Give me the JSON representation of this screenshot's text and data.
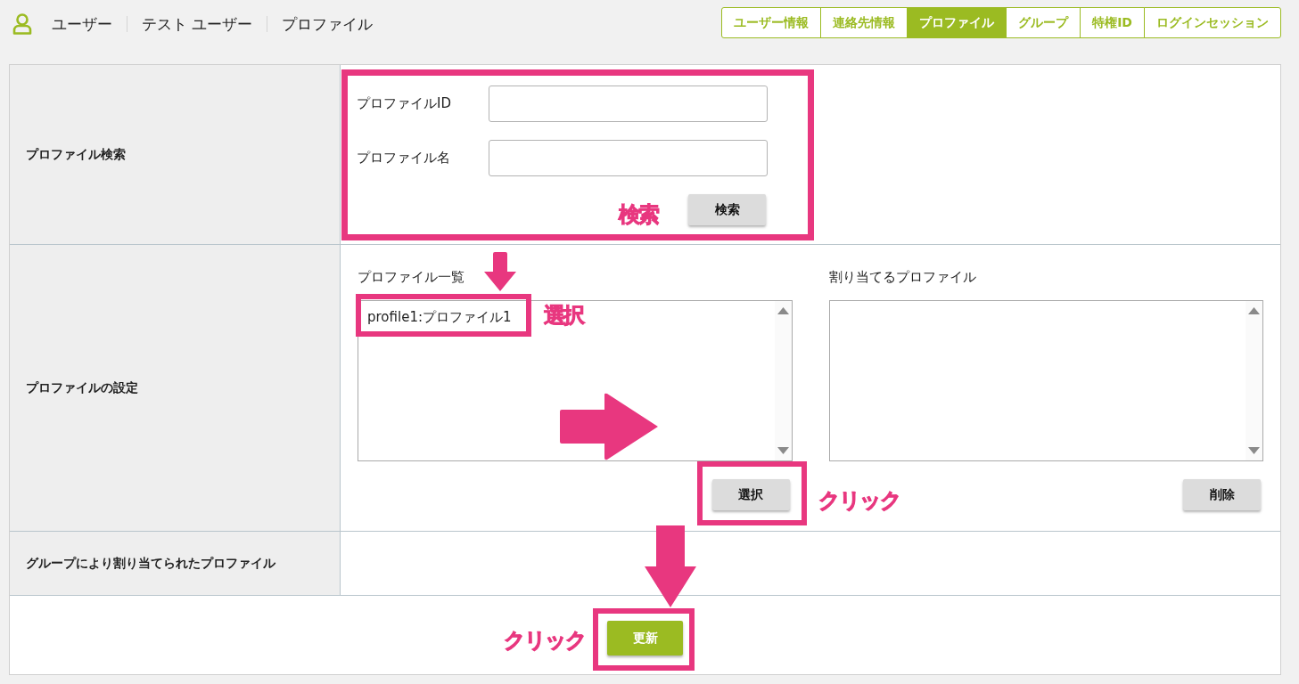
{
  "breadcrumb": [
    "ユーザー",
    "テスト ユーザー",
    "プロファイル"
  ],
  "tabs": [
    {
      "label": "ユーザー情報",
      "selected": false
    },
    {
      "label": "連絡先情報",
      "selected": false
    },
    {
      "label": "プロファイル",
      "selected": true
    },
    {
      "label": "グループ",
      "selected": false
    },
    {
      "label": "特権ID",
      "selected": false
    },
    {
      "label": "ログインセッション",
      "selected": false
    }
  ],
  "sections": [
    {
      "kind": "search",
      "label": "プロファイル検索",
      "fields": [
        {
          "label": "プロファイルID"
        },
        {
          "label": "プロファイル名"
        }
      ],
      "button": "検索"
    },
    {
      "kind": "assign",
      "label": "プロファイルの設定",
      "lists": [
        {
          "title": "プロファイル一覧",
          "items": [
            "profile1:プロファイル1"
          ],
          "button": "選択"
        },
        {
          "title": "割り当てるプロファイル",
          "button": "削除"
        }
      ]
    },
    {
      "kind": "plain",
      "label": "グループにより割り当てられたプロファイル"
    }
  ],
  "update_button": "更新",
  "annotation_notes": [
    "検索",
    "選択",
    "クリック",
    "クリック"
  ]
}
